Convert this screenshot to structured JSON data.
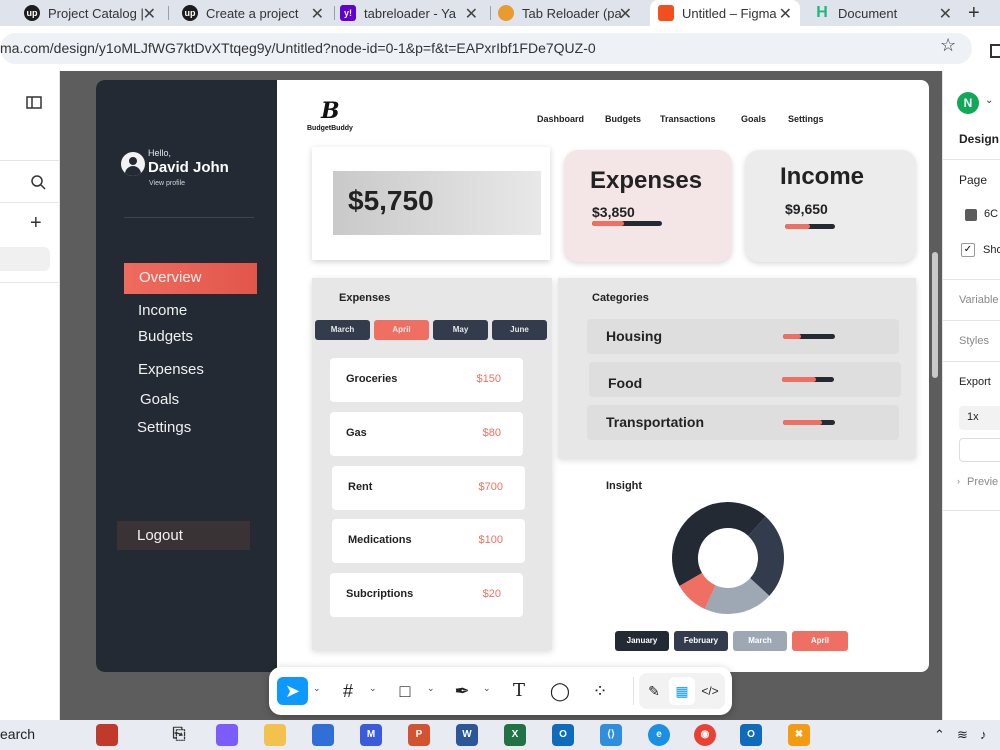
{
  "browser": {
    "tabs": [
      {
        "title": "Project Catalog |",
        "icon": "upwork-icon"
      },
      {
        "title": "Create a project",
        "icon": "upwork-icon"
      },
      {
        "title": "tabreloader - Ya",
        "icon": "yahoo-icon"
      },
      {
        "title": "Tab Reloader (pa",
        "icon": "tab-reloader-icon"
      },
      {
        "title": "Untitled – Figma",
        "icon": "figma-icon"
      },
      {
        "title": "Document",
        "icon": "document-h-icon"
      }
    ],
    "url": "ma.com/design/y1oMLJfWG7ktDvXTtqeg9y/Untitled?node-id=0-1&p=f&t=EAPxrIbf1FDe7QUZ-0"
  },
  "dashboard": {
    "sidebar": {
      "greeting": "Hello,",
      "user_name": "David John",
      "view_profile": "View profile",
      "nav": [
        "Overview",
        "Income",
        "Budgets",
        "Expenses",
        "Goals",
        "Settings"
      ],
      "active_nav": "Overview",
      "logout": "Logout"
    },
    "brand": {
      "logo_letter": "B",
      "name": "BudgetBuddy"
    },
    "topnav": [
      "Dashboard",
      "Budgets",
      "Transactions",
      "Goals",
      "Settings"
    ],
    "balance": "$5,750",
    "expenses_card": {
      "title": "Expenses",
      "amount": "$3,850",
      "progress": 0.45
    },
    "income_card": {
      "title": "Income",
      "amount": "$9,650",
      "progress": 0.5
    },
    "expenses_panel": {
      "title": "Expenses",
      "months": [
        "March",
        "April",
        "May",
        "June"
      ],
      "active_month": "April",
      "items": [
        {
          "name": "Groceries",
          "amount": "$150"
        },
        {
          "name": "Gas",
          "amount": "$80"
        },
        {
          "name": "Rent",
          "amount": "$700"
        },
        {
          "name": "Medications",
          "amount": "$100"
        },
        {
          "name": "Subcriptions",
          "amount": "$20"
        }
      ]
    },
    "categories_panel": {
      "title": "Categories",
      "items": [
        {
          "name": "Housing",
          "progress": 0.35
        },
        {
          "name": "Food",
          "progress": 0.65
        },
        {
          "name": "Transportation",
          "progress": 0.75
        }
      ]
    },
    "insight": {
      "title": "Insight",
      "months": [
        "January",
        "February",
        "March",
        "April"
      ],
      "colors": {
        "January": "#232a33",
        "February": "#323c4c",
        "March": "#9ea8b4",
        "April": "#ef6f62"
      }
    }
  },
  "chart_data": {
    "type": "pie",
    "title": "Insight",
    "categories": [
      "January",
      "February",
      "March",
      "April"
    ],
    "values": [
      45,
      25,
      20,
      10
    ],
    "colors": [
      "#232a33",
      "#323c4c",
      "#9ea8b4",
      "#ef6f62"
    ]
  },
  "figma": {
    "right_panel": {
      "avatar_letter": "N",
      "tab": "Design",
      "page_label": "Page",
      "page_color": "6C",
      "show_label": "Sho",
      "variables": "Variable",
      "styles": "Styles",
      "export": "Export",
      "export_scale": "1x",
      "preview": "Previe"
    },
    "toolbar": [
      "move-tool",
      "frame-tool",
      "shape-tool",
      "pen-tool",
      "text-tool",
      "comment-tool",
      "actions-tool",
      "draw-mode",
      "design-mode",
      "dev-mode"
    ]
  },
  "taskbar": {
    "search": "earch"
  }
}
